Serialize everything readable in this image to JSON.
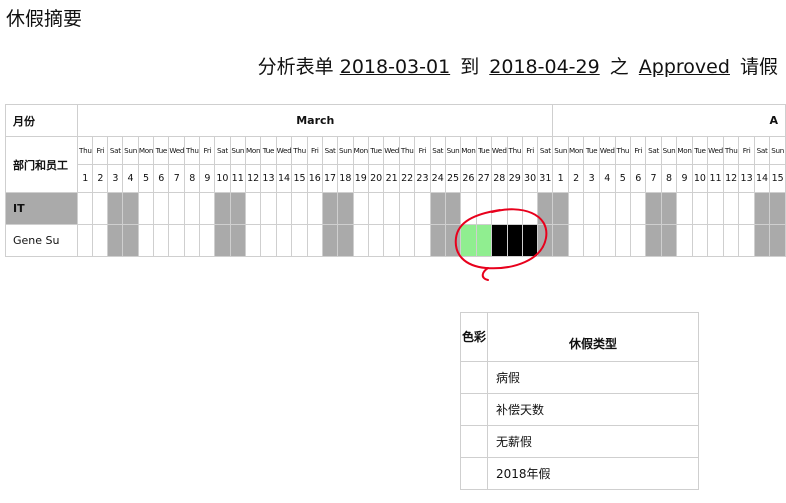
{
  "page_title": "休假摘要",
  "report": {
    "prefix": "分析表单",
    "date_from": "2018-03-01",
    "to_word": "到",
    "date_to": "2018-04-29",
    "of_word": "之",
    "state": "Approved",
    "suffix": "请假"
  },
  "table": {
    "month_label": "月份",
    "dept_employee_label": "部门和员工",
    "months": [
      "March",
      "A"
    ],
    "days": [
      {
        "n": "1",
        "d": "Thu"
      },
      {
        "n": "2",
        "d": "Fri"
      },
      {
        "n": "3",
        "d": "Sat",
        "w": true
      },
      {
        "n": "4",
        "d": "Sun",
        "w": true
      },
      {
        "n": "5",
        "d": "Mon"
      },
      {
        "n": "6",
        "d": "Tue"
      },
      {
        "n": "7",
        "d": "Wed"
      },
      {
        "n": "8",
        "d": "Thu"
      },
      {
        "n": "9",
        "d": "Fri"
      },
      {
        "n": "10",
        "d": "Sat",
        "w": true
      },
      {
        "n": "11",
        "d": "Sun",
        "w": true
      },
      {
        "n": "12",
        "d": "Mon"
      },
      {
        "n": "13",
        "d": "Tue"
      },
      {
        "n": "14",
        "d": "Wed"
      },
      {
        "n": "15",
        "d": "Thu"
      },
      {
        "n": "16",
        "d": "Fri"
      },
      {
        "n": "17",
        "d": "Sat",
        "w": true
      },
      {
        "n": "18",
        "d": "Sun",
        "w": true
      },
      {
        "n": "19",
        "d": "Mon"
      },
      {
        "n": "20",
        "d": "Tue"
      },
      {
        "n": "21",
        "d": "Wed"
      },
      {
        "n": "22",
        "d": "Thu"
      },
      {
        "n": "23",
        "d": "Fri"
      },
      {
        "n": "24",
        "d": "Sat",
        "w": true
      },
      {
        "n": "25",
        "d": "Sun",
        "w": true
      },
      {
        "n": "26",
        "d": "Mon"
      },
      {
        "n": "27",
        "d": "Tue"
      },
      {
        "n": "28",
        "d": "Wed"
      },
      {
        "n": "29",
        "d": "Thu"
      },
      {
        "n": "30",
        "d": "Fri"
      },
      {
        "n": "31",
        "d": "Sat",
        "w": true
      },
      {
        "n": "1",
        "d": "Sun",
        "w": true
      },
      {
        "n": "2",
        "d": "Mon"
      },
      {
        "n": "3",
        "d": "Tue"
      },
      {
        "n": "4",
        "d": "Wed"
      },
      {
        "n": "5",
        "d": "Thu"
      },
      {
        "n": "6",
        "d": "Fri"
      },
      {
        "n": "7",
        "d": "Sat",
        "w": true
      },
      {
        "n": "8",
        "d": "Sun",
        "w": true
      },
      {
        "n": "9",
        "d": "Mon"
      },
      {
        "n": "10",
        "d": "Tue"
      },
      {
        "n": "11",
        "d": "Wed"
      },
      {
        "n": "12",
        "d": "Thu"
      },
      {
        "n": "13",
        "d": "Fri"
      },
      {
        "n": "14",
        "d": "Sat",
        "w": true
      },
      {
        "n": "15",
        "d": "Sun",
        "w": true
      }
    ],
    "department": "IT",
    "employee": {
      "name": "Gene Su",
      "leave_days": [
        {
          "day_index": 25,
          "type": "sick"
        },
        {
          "day_index": 26,
          "type": "sick"
        },
        {
          "day_index": 27,
          "type": "black"
        },
        {
          "day_index": 28,
          "type": "black"
        },
        {
          "day_index": 29,
          "type": "black"
        }
      ]
    }
  },
  "legend": {
    "color_header": "色彩",
    "type_header": "休假类型",
    "items": [
      {
        "label": "病假"
      },
      {
        "label": "补偿天数"
      },
      {
        "label": "无薪假"
      },
      {
        "label": "2018年假"
      }
    ]
  },
  "colors": {
    "weekend": "#aaaaaa",
    "department_row": "#aaaaaa",
    "leave_sick": "#90ee90",
    "leave_black": "#000000",
    "annotation": "#e8001c"
  }
}
